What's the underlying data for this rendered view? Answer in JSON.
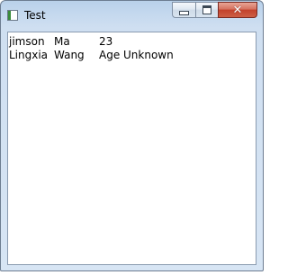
{
  "window": {
    "title": "Test"
  },
  "caption_buttons": {
    "minimize": "minimize",
    "maximize": "maximize",
    "close": "close"
  },
  "rows": [
    {
      "first": "jimson",
      "last": "Ma",
      "age": "23"
    },
    {
      "first": "Lingxia",
      "last": "Wang",
      "age": "Age Unknown"
    }
  ]
}
